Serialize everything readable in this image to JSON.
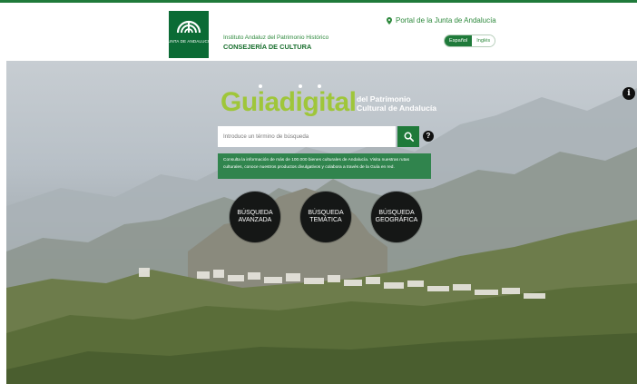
{
  "header": {
    "logo_text": "JUNTA DE ANDALUCIA",
    "institute": "Instituto Andaluz del Patrimonio Histórico",
    "department": "CONSEJERÍA DE CULTURA",
    "portal_link": "Portal de la Junta de Andalucía",
    "languages": {
      "active": "Español",
      "other": "Inglés"
    }
  },
  "hero": {
    "brand": "Guiadigital",
    "brand_sub_line1": "del Patrimonio",
    "brand_sub_line2": "Cultural de Andalucía",
    "info_icon": "info-icon",
    "search": {
      "placeholder": "Introduce un término de búsqueda",
      "button_icon": "search-icon",
      "help_label": "?"
    },
    "description": "Consulta la información de más de 100.000 bienes culturales de Andalucía. Visita nuestras rutas culturales, conoce nuestros productos divulgativos y colabora a través de la Guía en red.",
    "buttons": [
      {
        "line1": "BÚSQUEDA",
        "line2": "AVANZADA"
      },
      {
        "line1": "BÚSQUEDA",
        "line2": "TEMÁTICA"
      },
      {
        "line1": "BÚSQUEDA",
        "line2": "GEOGRÁFICA"
      }
    ]
  },
  "colors": {
    "brand_green": "#1f7a3a",
    "guia_green": "#9fc63a",
    "circle_dark": "#151716"
  }
}
